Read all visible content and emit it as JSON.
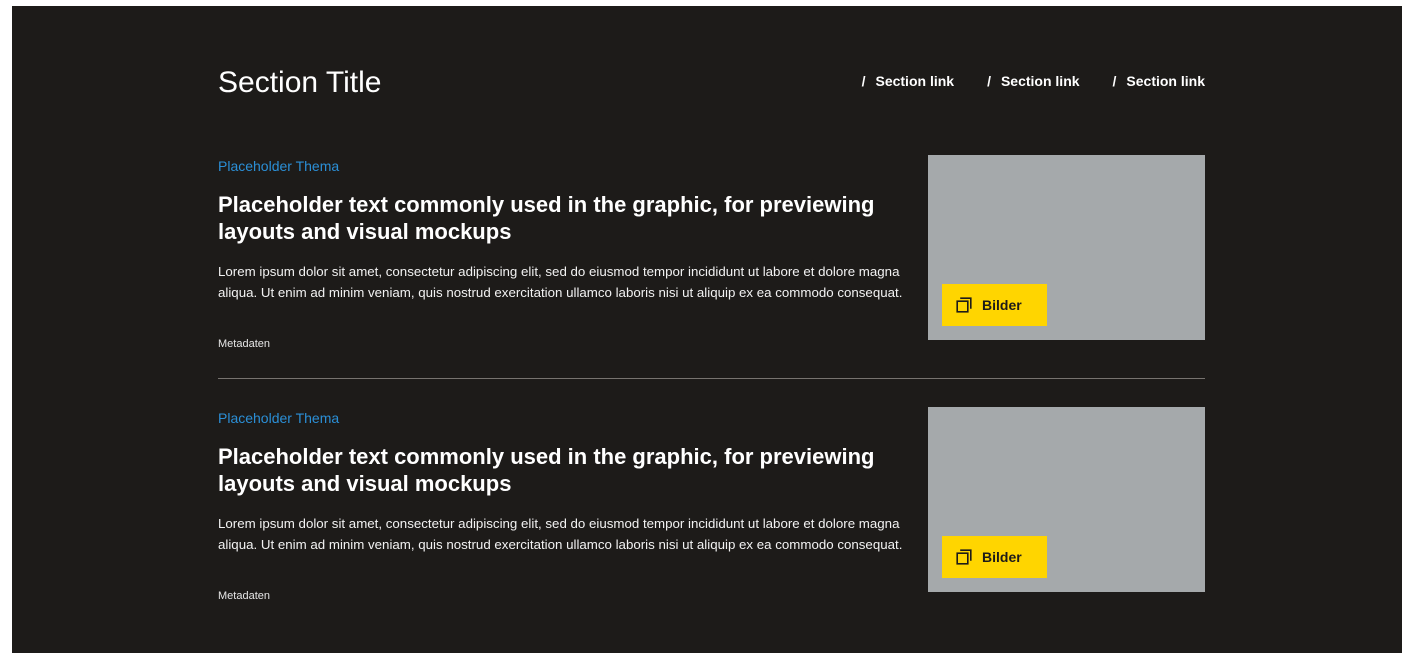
{
  "section": {
    "title": "Section Title",
    "links": [
      {
        "slash": "/",
        "label": "Section link"
      },
      {
        "slash": "/",
        "label": "Section link"
      },
      {
        "slash": "/",
        "label": "Section link"
      }
    ]
  },
  "articles": [
    {
      "theme": "Placeholder Thema",
      "headline": "Placeholder text commonly used in the graphic, for previewing layouts and visual mockups",
      "teaser": "Lorem ipsum dolor sit amet, consectetur adipiscing elit, sed do eiusmod tempor incididunt ut labore et dolore magna aliqua. Ut enim ad minim veniam, quis nostrud exercitation ullamco laboris nisi ut aliquip ex ea commodo consequat.",
      "meta": "Metadaten",
      "image_button": {
        "label": "Bilder",
        "icon": "gallery-icon"
      }
    },
    {
      "theme": "Placeholder Thema",
      "headline": "Placeholder text commonly used in the graphic, for previewing layouts and visual mockups",
      "teaser": "Lorem ipsum dolor sit amet, consectetur adipiscing elit, sed do eiusmod tempor incididunt ut labore et dolore magna aliqua. Ut enim ad minim veniam, quis nostrud exercitation ullamco laboris nisi ut aliquip ex ea commodo consequat.",
      "meta": "Metadaten",
      "image_button": {
        "label": "Bilder",
        "icon": "gallery-icon"
      }
    }
  ],
  "colors": {
    "background": "#1d1b19",
    "theme_link": "#2b8fd6",
    "image_placeholder": "#a5a9ab",
    "button": "#ffd500",
    "divider": "#77736f"
  }
}
